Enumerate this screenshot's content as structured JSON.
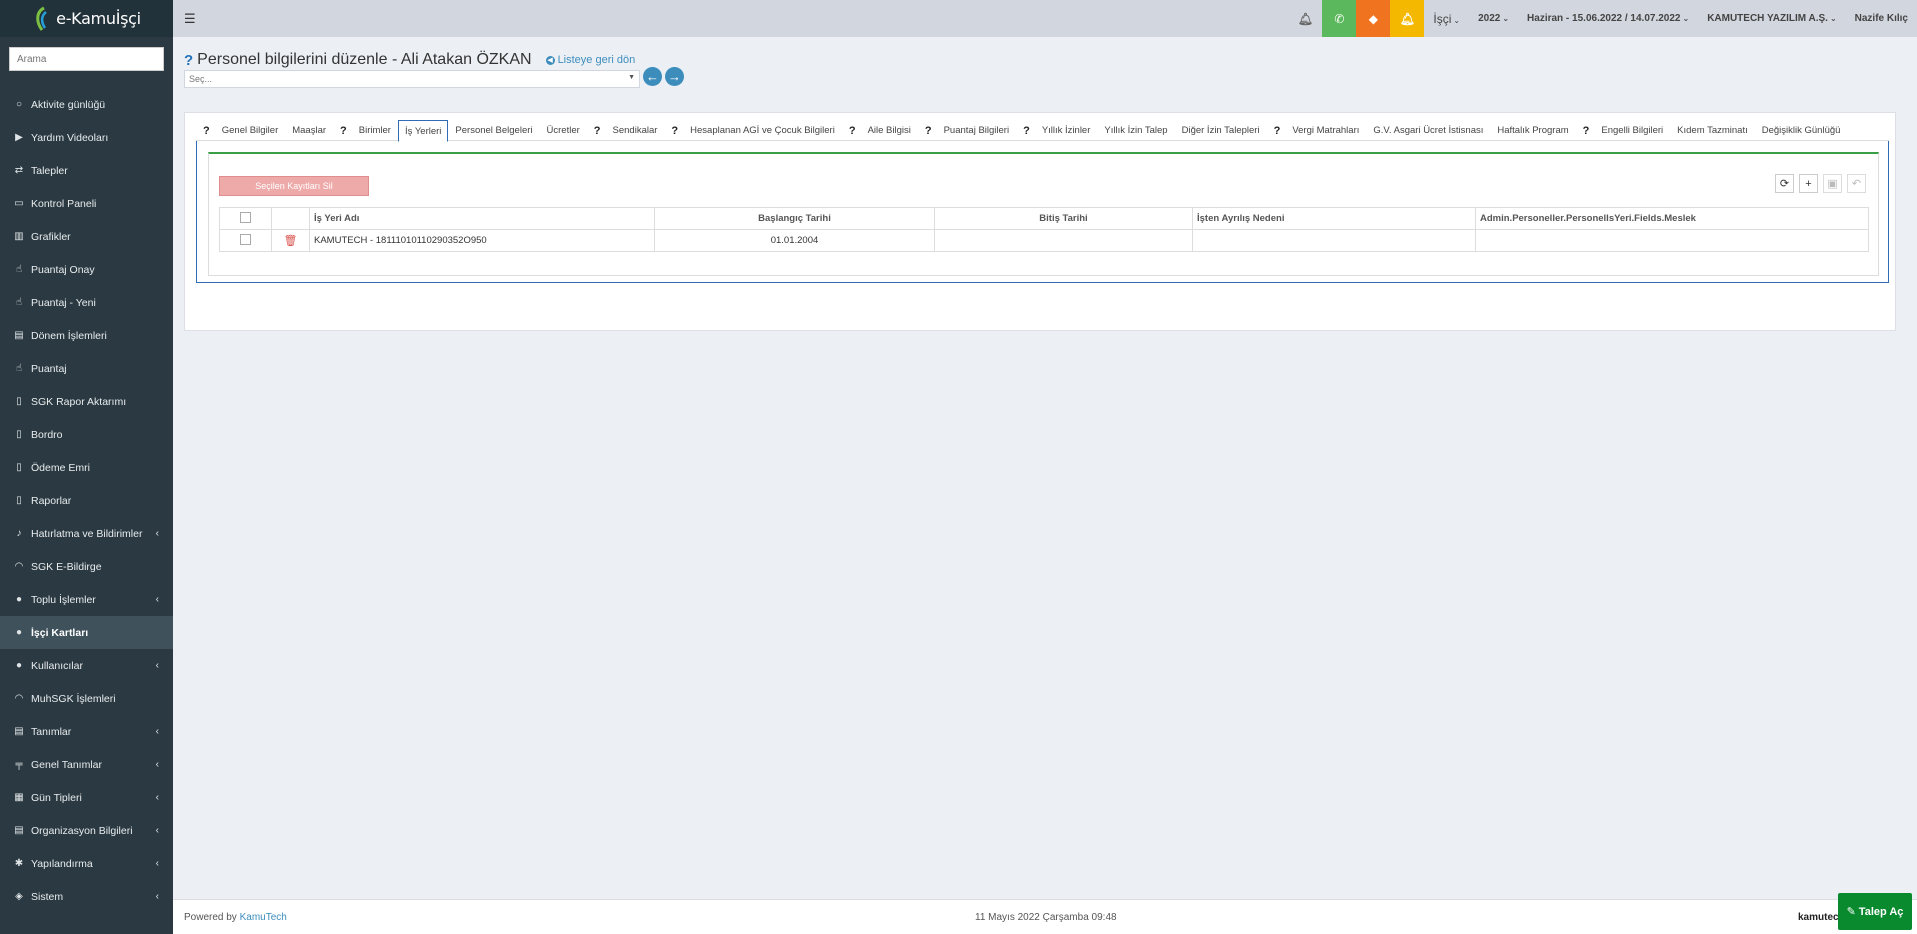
{
  "app": {
    "brand": "e-Kamuİşçi"
  },
  "sidebar": {
    "search_placeholder": "Arama",
    "items": [
      {
        "label": "Aktivite günlüğü",
        "icon": "circle-icon",
        "chevron": false
      },
      {
        "label": "Yardım Videoları",
        "icon": "video-icon",
        "chevron": false
      },
      {
        "label": "Talepler",
        "icon": "exchange-icon",
        "chevron": false
      },
      {
        "label": "Kontrol Paneli",
        "icon": "monitor-icon",
        "chevron": false
      },
      {
        "label": "Grafikler",
        "icon": "chart-icon",
        "chevron": false
      },
      {
        "label": "Puantaj Onay",
        "icon": "hand-icon",
        "chevron": false
      },
      {
        "label": "Puantaj - Yeni",
        "icon": "hand-icon",
        "chevron": false
      },
      {
        "label": "Dönem İşlemleri",
        "icon": "map-icon",
        "chevron": false
      },
      {
        "label": "Puantaj",
        "icon": "hand-icon",
        "chevron": false
      },
      {
        "label": "SGK Rapor Aktarımı",
        "icon": "file-icon",
        "chevron": false
      },
      {
        "label": "Bordro",
        "icon": "file-icon",
        "chevron": false
      },
      {
        "label": "Ödeme Emri",
        "icon": "file-icon",
        "chevron": false
      },
      {
        "label": "Raporlar",
        "icon": "file-icon",
        "chevron": false
      },
      {
        "label": "Hatırlatma ve Bildirimler",
        "icon": "bell-icon",
        "chevron": true
      },
      {
        "label": "SGK E-Bildirge",
        "icon": "rss-icon",
        "chevron": false
      },
      {
        "label": "Toplu İşlemler",
        "icon": "user-icon",
        "chevron": true
      },
      {
        "label": "İşçi Kartları",
        "icon": "users-icon",
        "chevron": false,
        "active": true
      },
      {
        "label": "Kullanıcılar",
        "icon": "user-icon",
        "chevron": true
      },
      {
        "label": "MuhSGK İşlemleri",
        "icon": "rss-icon",
        "chevron": false
      },
      {
        "label": "Tanımlar",
        "icon": "map-icon",
        "chevron": true
      },
      {
        "label": "Genel Tanımlar",
        "icon": "sign-icon",
        "chevron": true
      },
      {
        "label": "Gün Tipleri",
        "icon": "calendar-icon",
        "chevron": true
      },
      {
        "label": "Organizasyon Bilgileri",
        "icon": "map-icon",
        "chevron": true
      },
      {
        "label": "Yapılandırma",
        "icon": "gear-icon",
        "chevron": true
      },
      {
        "label": "Sistem",
        "icon": "cube-icon",
        "chevron": true
      }
    ]
  },
  "topbar": {
    "role": "İşçi",
    "year": "2022",
    "period": "Haziran - 15.06.2022 / 14.07.2022",
    "company": "KAMUTECH YAZILIM A.Ş.",
    "user": "Nazife Kılıç",
    "colors": {
      "phone": "#5cb85c",
      "ticket": "#f0741f",
      "alert": "#f5b800"
    }
  },
  "page": {
    "title": "Personel bilgilerini düzenle - Ali Atakan ÖZKAN",
    "back_link": "Listeye geri dön",
    "select_placeholder": "Seç..."
  },
  "tabs": [
    {
      "label": "Genel Bilgiler",
      "help": true
    },
    {
      "label": "Maaşlar",
      "help": false
    },
    {
      "label": "Birimler",
      "help": true
    },
    {
      "label": "İş Yerleri",
      "help": false,
      "active": true
    },
    {
      "label": "Personel Belgeleri",
      "help": false
    },
    {
      "label": "Ücretler",
      "help": false
    },
    {
      "label": "Sendikalar",
      "help": true
    },
    {
      "label": "Hesaplanan AGİ ve Çocuk Bilgileri",
      "help": true
    },
    {
      "label": "Aile Bilgisi",
      "help": true
    },
    {
      "label": "Puantaj Bilgileri",
      "help": true
    },
    {
      "label": "Yıllık İzinler",
      "help": true
    },
    {
      "label": "Yıllık İzin Talep",
      "help": false
    },
    {
      "label": "Diğer İzin Talepleri",
      "help": false
    },
    {
      "label": "Vergi Matrahları",
      "help": true
    },
    {
      "label": "G.V. Asgari Ücret İstisnası",
      "help": false
    },
    {
      "label": "Haftalık Program",
      "help": false
    },
    {
      "label": "Engelli Bilgileri",
      "help": true
    },
    {
      "label": "Kıdem Tazminatı",
      "help": false
    },
    {
      "label": "Değişiklik Günlüğü",
      "help": false
    }
  ],
  "grid": {
    "delete_selected_label": "Seçilen Kayıtları Sil",
    "columns": [
      "İş Yeri Adı",
      "Başlangıç Tarihi",
      "Bitiş Tarihi",
      "İşten Ayrılış Nedeni",
      "Admin.Personeller.PersonelIsYeri.Fields.Meslek"
    ],
    "rows": [
      {
        "workplace": "KAMUTECH - 18111010110290352O950",
        "start": "01.01.2004",
        "end": "",
        "reason": "",
        "job": ""
      }
    ]
  },
  "footer": {
    "powered_prefix": "Powered by",
    "powered_brand": "KamuTech",
    "datetime": "11 Mayıs 2022 Çarşamba 09:48",
    "brand_right": "kamutec",
    "talep_label": "Talep Aç"
  }
}
